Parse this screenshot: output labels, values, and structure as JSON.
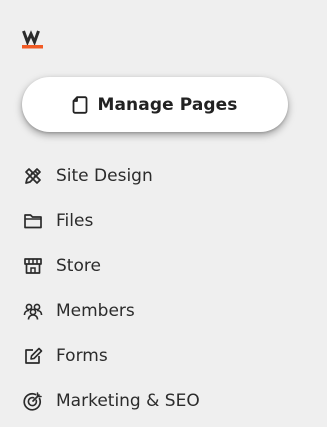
{
  "app": {
    "logo_letter": "W",
    "accent_color": "#f15a24"
  },
  "manage_pages": {
    "label": "Manage Pages",
    "icon": "page-icon"
  },
  "sidebar": {
    "items": [
      {
        "label": "Site Design",
        "icon": "design-tools-icon"
      },
      {
        "label": "Files",
        "icon": "folder-icon"
      },
      {
        "label": "Store",
        "icon": "store-icon"
      },
      {
        "label": "Members",
        "icon": "members-icon"
      },
      {
        "label": "Forms",
        "icon": "form-edit-icon"
      },
      {
        "label": "Marketing & SEO",
        "icon": "target-icon"
      }
    ]
  }
}
